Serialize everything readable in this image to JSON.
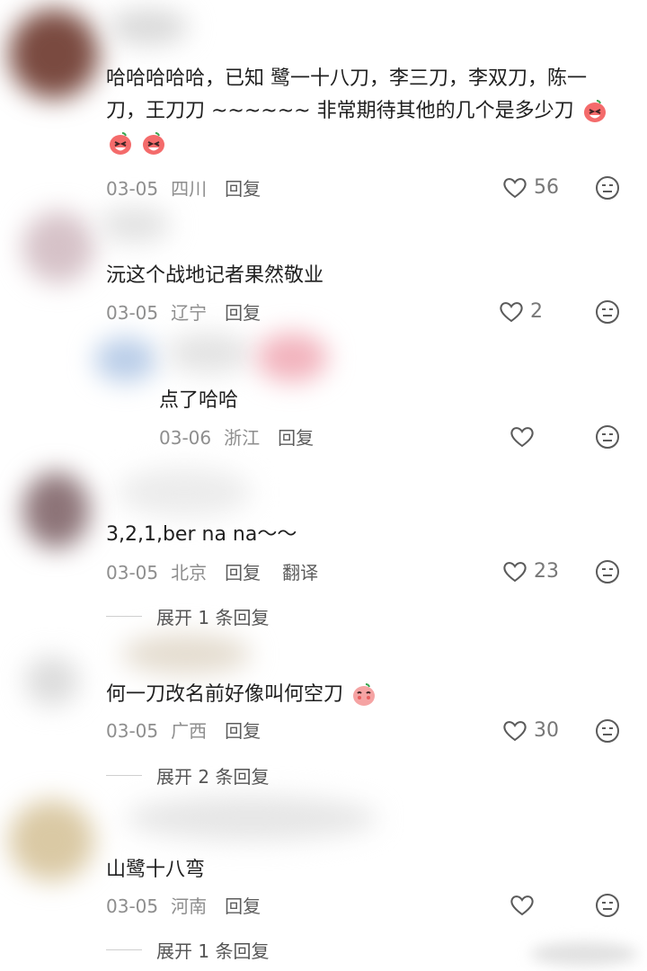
{
  "comments": [
    {
      "text": "哈哈哈哈哈，已知 鹭一十八刀，李三刀，李双刀，陈一刀，王刀刀 ~~~~~~ 非常期待其他的几个是多少刀",
      "emoji_icons": [
        "laughing-face-icon",
        "laughing-face-icon",
        "laughing-face-icon"
      ],
      "date": "03-05",
      "region": "四川",
      "reply_label": "回复",
      "likes": "56"
    },
    {
      "text": "沅这个战地记者果然敬业",
      "date": "03-05",
      "region": "辽宁",
      "reply_label": "回复",
      "likes": "2"
    },
    {
      "text": "点了哈哈",
      "date": "03-06",
      "region": "浙江",
      "reply_label": "回复",
      "likes": ""
    },
    {
      "text": "3,2,1,ber na na～～",
      "date": "03-05",
      "region": "北京",
      "reply_label": "回复",
      "translate_label": "翻译",
      "likes": "23",
      "expand_label": "展开 1 条回复"
    },
    {
      "text": "何一刀改名前好像叫何空刀",
      "emoji_icons": [
        "blushing-face-icon"
      ],
      "date": "03-05",
      "region": "广西",
      "reply_label": "回复",
      "likes": "30",
      "expand_label": "展开 2 条回复"
    },
    {
      "text": "山鹭十八弯",
      "date": "03-05",
      "region": "河南",
      "reply_label": "回复",
      "likes": "",
      "expand_label": "展开 1 条回复"
    }
  ],
  "icons": {
    "like": "heart-icon",
    "dislike": "dislike-face-icon"
  },
  "colors": {
    "text": "#1f1f1f",
    "meta": "#8e8e8e",
    "icon": "#5a5a5a"
  }
}
